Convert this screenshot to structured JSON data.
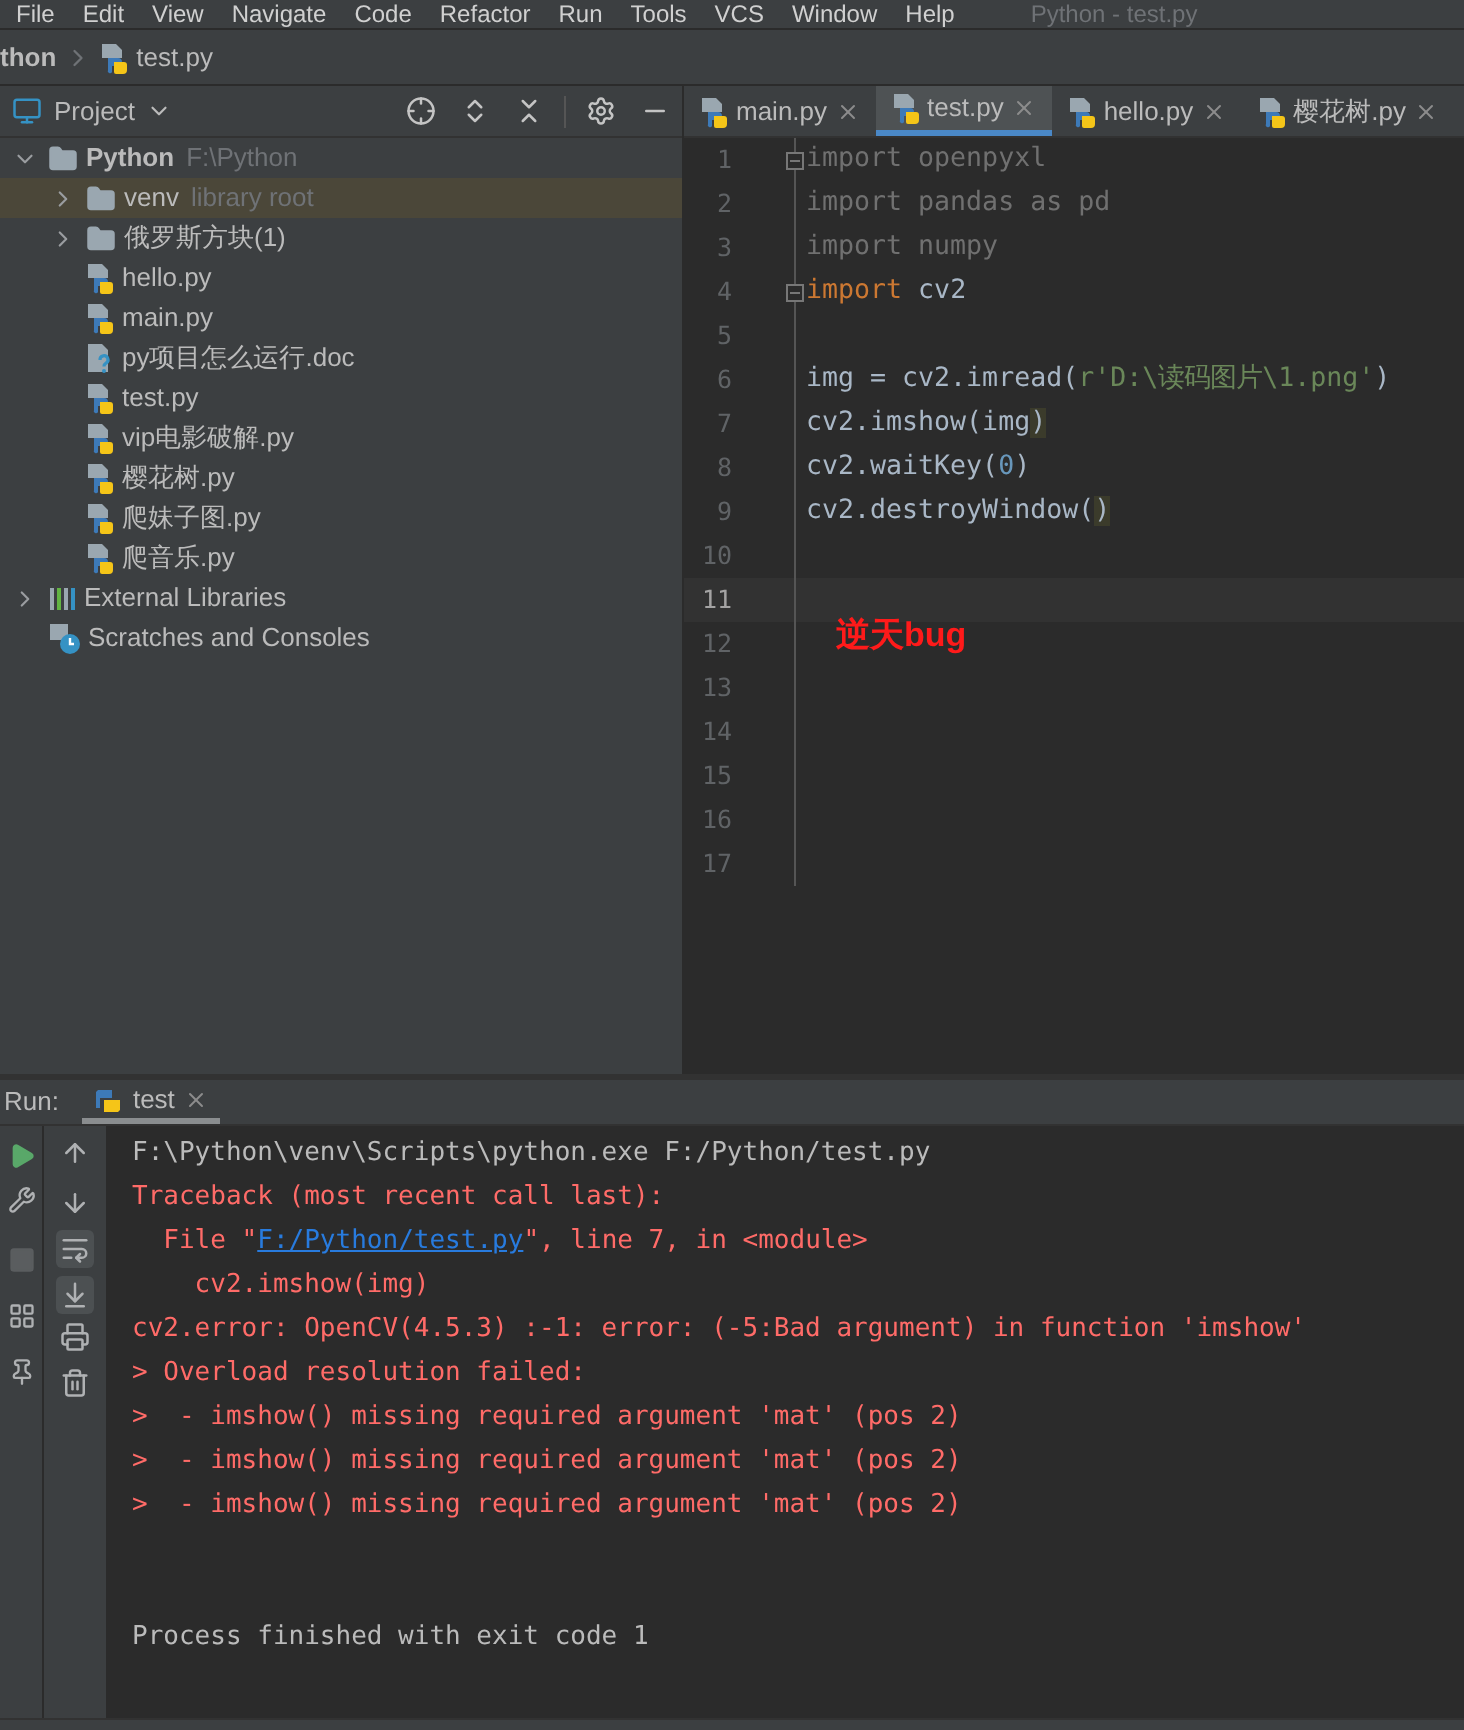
{
  "menu_bar": {
    "items": [
      "File",
      "Edit",
      "View",
      "Navigate",
      "Code",
      "Refactor",
      "Run",
      "Tools",
      "VCS",
      "Window",
      "Help"
    ],
    "title": "Python - test.py"
  },
  "breadcrumbs": [
    "thon",
    "test.py"
  ],
  "project_panel": {
    "title": "Project",
    "tree": [
      {
        "label": "Python",
        "hint": "F:\\Python",
        "kind": "folder",
        "expanded": true,
        "selected": false,
        "children": [
          {
            "label": "venv",
            "hint": "library root",
            "kind": "folder",
            "expanded": false,
            "selected": true
          },
          {
            "label": "俄罗斯方块(1)",
            "kind": "folder",
            "expanded": false,
            "selected": false
          },
          {
            "label": "hello.py",
            "kind": "python",
            "selected": false
          },
          {
            "label": "main.py",
            "kind": "python",
            "selected": false
          },
          {
            "label": "py项目怎么运行.doc",
            "kind": "doc",
            "selected": false
          },
          {
            "label": "test.py",
            "kind": "python",
            "selected": false
          },
          {
            "label": "vip电影破解.py",
            "kind": "python",
            "selected": false
          },
          {
            "label": "樱花树.py",
            "kind": "python",
            "selected": false
          },
          {
            "label": "爬妹子图.py",
            "kind": "python",
            "selected": false
          },
          {
            "label": "爬音乐.py",
            "kind": "python",
            "selected": false
          }
        ]
      },
      {
        "label": "External Libraries",
        "kind": "libraries",
        "expanded": false,
        "selected": false
      },
      {
        "label": "Scratches and Consoles",
        "kind": "scratches",
        "selected": false
      }
    ]
  },
  "editor_tabs": [
    {
      "label": "main.py",
      "selected": false
    },
    {
      "label": "test.py",
      "selected": true
    },
    {
      "label": "hello.py",
      "selected": false
    },
    {
      "label": "樱花树.py",
      "selected": false
    }
  ],
  "editor": {
    "lines": [
      {
        "number": "1",
        "fold": true,
        "current": false,
        "tokens": [
          {
            "text": "import openpyxl",
            "kind": "unused"
          }
        ]
      },
      {
        "number": "2",
        "fold": false,
        "current": false,
        "tokens": [
          {
            "text": "import pandas as pd",
            "kind": "unused"
          }
        ]
      },
      {
        "number": "3",
        "fold": false,
        "current": false,
        "tokens": [
          {
            "text": "import numpy",
            "kind": "unused"
          }
        ]
      },
      {
        "number": "4",
        "fold": true,
        "current": false,
        "tokens": [
          {
            "text": "import",
            "kind": "keyword"
          },
          {
            "text": " cv2",
            "kind": "plain"
          }
        ]
      },
      {
        "number": "5",
        "fold": false,
        "current": false
      },
      {
        "number": "6",
        "fold": false,
        "current": false,
        "tokens": [
          {
            "text": "img = cv2.imread(",
            "kind": "plain"
          },
          {
            "text": "r'D:\\读码图片\\1.png'",
            "kind": "string"
          },
          {
            "text": ")",
            "kind": "plain"
          }
        ]
      },
      {
        "number": "7",
        "fold": false,
        "current": false,
        "tokens": [
          {
            "text": "cv2.imshow(img",
            "kind": "plain"
          },
          {
            "text": ")",
            "kind": "brace"
          }
        ]
      },
      {
        "number": "8",
        "fold": false,
        "current": false,
        "tokens": [
          {
            "text": "cv2.waitKey(",
            "kind": "plain"
          },
          {
            "text": "0",
            "kind": "number"
          },
          {
            "text": ")",
            "kind": "plain"
          }
        ]
      },
      {
        "number": "9",
        "fold": false,
        "current": false,
        "tokens": [
          {
            "text": "cv2.destroyWindow(",
            "kind": "plain"
          },
          {
            "text": ")",
            "kind": "brace"
          }
        ]
      },
      {
        "number": "10",
        "fold": false,
        "current": false
      },
      {
        "number": "11",
        "fold": false,
        "current": true
      },
      {
        "number": "12",
        "fold": false,
        "current": false
      },
      {
        "number": "13",
        "fold": false,
        "current": false
      },
      {
        "number": "14",
        "fold": false,
        "current": false
      },
      {
        "number": "15",
        "fold": false,
        "current": false
      },
      {
        "number": "16",
        "fold": false,
        "current": false
      },
      {
        "number": "17",
        "fold": false,
        "current": false
      }
    ],
    "annotation": "逆天bug"
  },
  "run_panel": {
    "label": "Run:",
    "tabs": [
      {
        "label": "test",
        "selected": true
      }
    ],
    "console": [
      {
        "kind": "normal",
        "parts": [
          {
            "text": "F:\\Python\\venv\\Scripts\\python.exe F:/Python/test.py",
            "kind": "text"
          }
        ]
      },
      {
        "kind": "error",
        "parts": [
          {
            "text": "Traceback (most recent call last):",
            "kind": "text"
          }
        ]
      },
      {
        "kind": "error",
        "parts": [
          {
            "text": "  File \"",
            "kind": "text"
          },
          {
            "text": "F:/Python/test.py",
            "kind": "link"
          },
          {
            "text": "\", line 7, in <module>",
            "kind": "text"
          }
        ]
      },
      {
        "kind": "error",
        "parts": [
          {
            "text": "    cv2.imshow(img)",
            "kind": "text"
          }
        ]
      },
      {
        "kind": "error",
        "parts": [
          {
            "text": "cv2.error: OpenCV(4.5.3) :-1: error: (-5:Bad argument) in function 'imshow'",
            "kind": "text"
          }
        ]
      },
      {
        "kind": "error",
        "parts": [
          {
            "text": "> Overload resolution failed:",
            "kind": "text"
          }
        ]
      },
      {
        "kind": "error",
        "parts": [
          {
            "text": ">  - imshow() missing required argument 'mat' (pos 2)",
            "kind": "text"
          }
        ]
      },
      {
        "kind": "error",
        "parts": [
          {
            "text": ">  - imshow() missing required argument 'mat' (pos 2)",
            "kind": "text"
          }
        ]
      },
      {
        "kind": "error",
        "parts": [
          {
            "text": ">  - imshow() missing required argument 'mat' (pos 2)",
            "kind": "text"
          }
        ]
      },
      {
        "kind": "blank"
      },
      {
        "kind": "blank"
      },
      {
        "kind": "normal",
        "parts": [
          {
            "text": "Process finished with exit code 1",
            "kind": "text"
          }
        ]
      }
    ]
  }
}
